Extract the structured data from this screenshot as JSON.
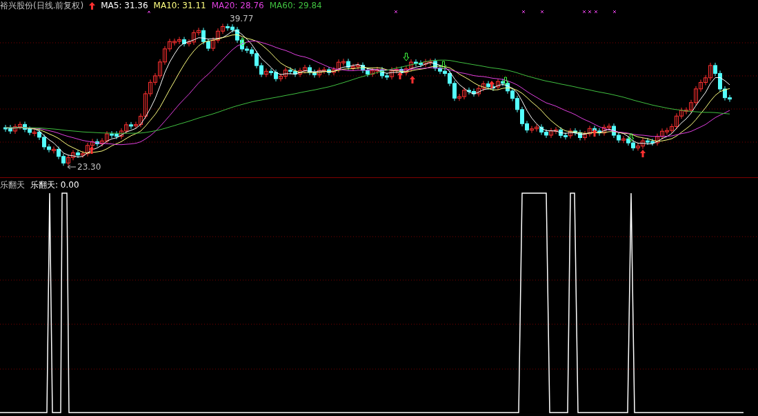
{
  "price_pane": {
    "title": "裕兴股份(日线.前复权)",
    "indicators": [
      {
        "label": "MA5: 31.36",
        "color": "#ffffff"
      },
      {
        "label": "MA10: 31.11",
        "color": "#ffff80"
      },
      {
        "label": "MA20: 28.76",
        "color": "#e040e0"
      },
      {
        "label": "MA60: 29.84",
        "color": "#40c040"
      }
    ],
    "high_label": "39.77",
    "low_label": "23.30"
  },
  "indicator_pane": {
    "title": "乐翻天",
    "indicators": [
      {
        "label": "乐翻天: 0.00",
        "color": "#ffffff"
      }
    ]
  }
}
